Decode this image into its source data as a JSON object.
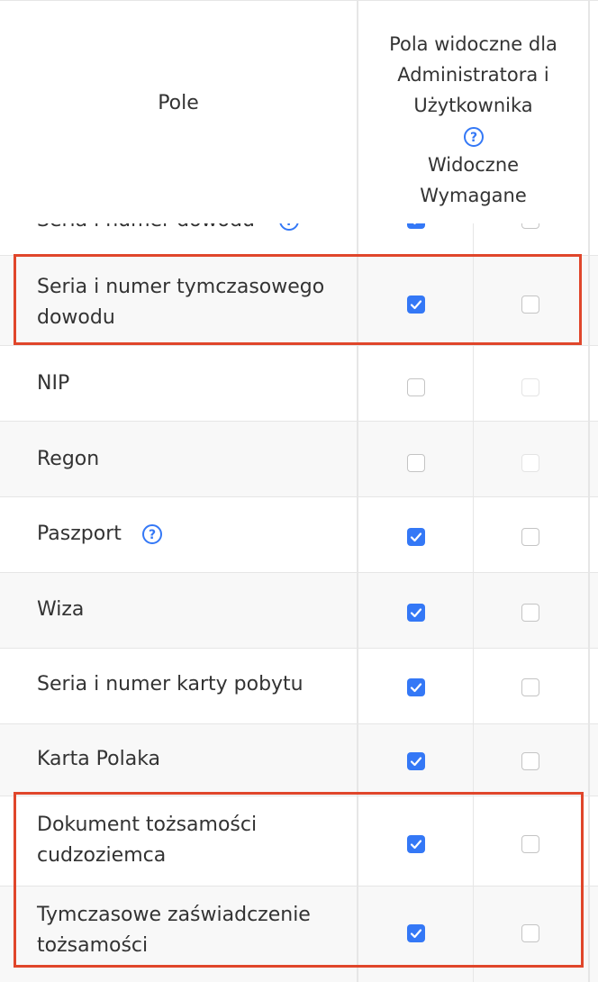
{
  "header": {
    "field_col": "Pole",
    "visible_col_line1": "Pola widoczne dla",
    "visible_col_line2": "Administratora i",
    "visible_col_line3": "Użytkownika",
    "help_icon": "question-circle-icon",
    "sub_visible": "Widoczne",
    "sub_required": "Wymagane"
  },
  "partial_row": {
    "label": "Seria i numer dowodu",
    "visible": true,
    "required": false
  },
  "rows": [
    {
      "label_line1": "Seria i numer tymczasowego",
      "label_line2": "dowodu",
      "visible": true,
      "required": false
    },
    {
      "label_line1": "NIP",
      "label_line2": "",
      "visible": false,
      "required": false
    },
    {
      "label_line1": "Regon",
      "label_line2": "",
      "visible": false,
      "required": false
    },
    {
      "label_line1": "Paszport",
      "label_line2": "",
      "visible": true,
      "required": false
    },
    {
      "label_line1": "Wiza",
      "label_line2": "",
      "visible": true,
      "required": false
    },
    {
      "label_line1": "Seria i numer karty pobytu",
      "label_line2": "",
      "visible": true,
      "required": false
    },
    {
      "label_line1": "Karta Polaka",
      "label_line2": "",
      "visible": true,
      "required": false
    },
    {
      "label_line1": "Dokument tożsamości",
      "label_line2": "cudzoziemca",
      "visible": true,
      "required": false
    },
    {
      "label_line1": "Tymczasowe zaświadczenie",
      "label_line2": "tożsamości",
      "visible": true,
      "required": false
    }
  ],
  "colors": {
    "accent": "#3478f6",
    "highlight": "#e0462b",
    "row_alt": "#f8f8f8",
    "border": "#e6e6e6"
  }
}
